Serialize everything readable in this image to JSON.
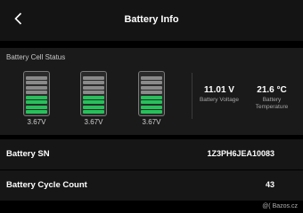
{
  "header": {
    "title": "Battery Info"
  },
  "status": {
    "section_label": "Battery Cell Status",
    "cells": [
      {
        "voltage": "3.67V"
      },
      {
        "voltage": "3.67V"
      },
      {
        "voltage": "3.67V"
      }
    ],
    "voltage": {
      "value": "11.01 V",
      "label": "Battery Voltage"
    },
    "temperature": {
      "value": "21.6 °C",
      "label_line1": "Battery",
      "label_line2": "Temperature"
    }
  },
  "rows": [
    {
      "label": "Battery SN",
      "value": "1Z3PH6JEA10083"
    },
    {
      "label": "Battery Cycle Count",
      "value": "43"
    }
  ],
  "watermark": "@( Bazos.cz",
  "colors": {
    "accent_green": "#25c25a",
    "background": "#000000"
  }
}
